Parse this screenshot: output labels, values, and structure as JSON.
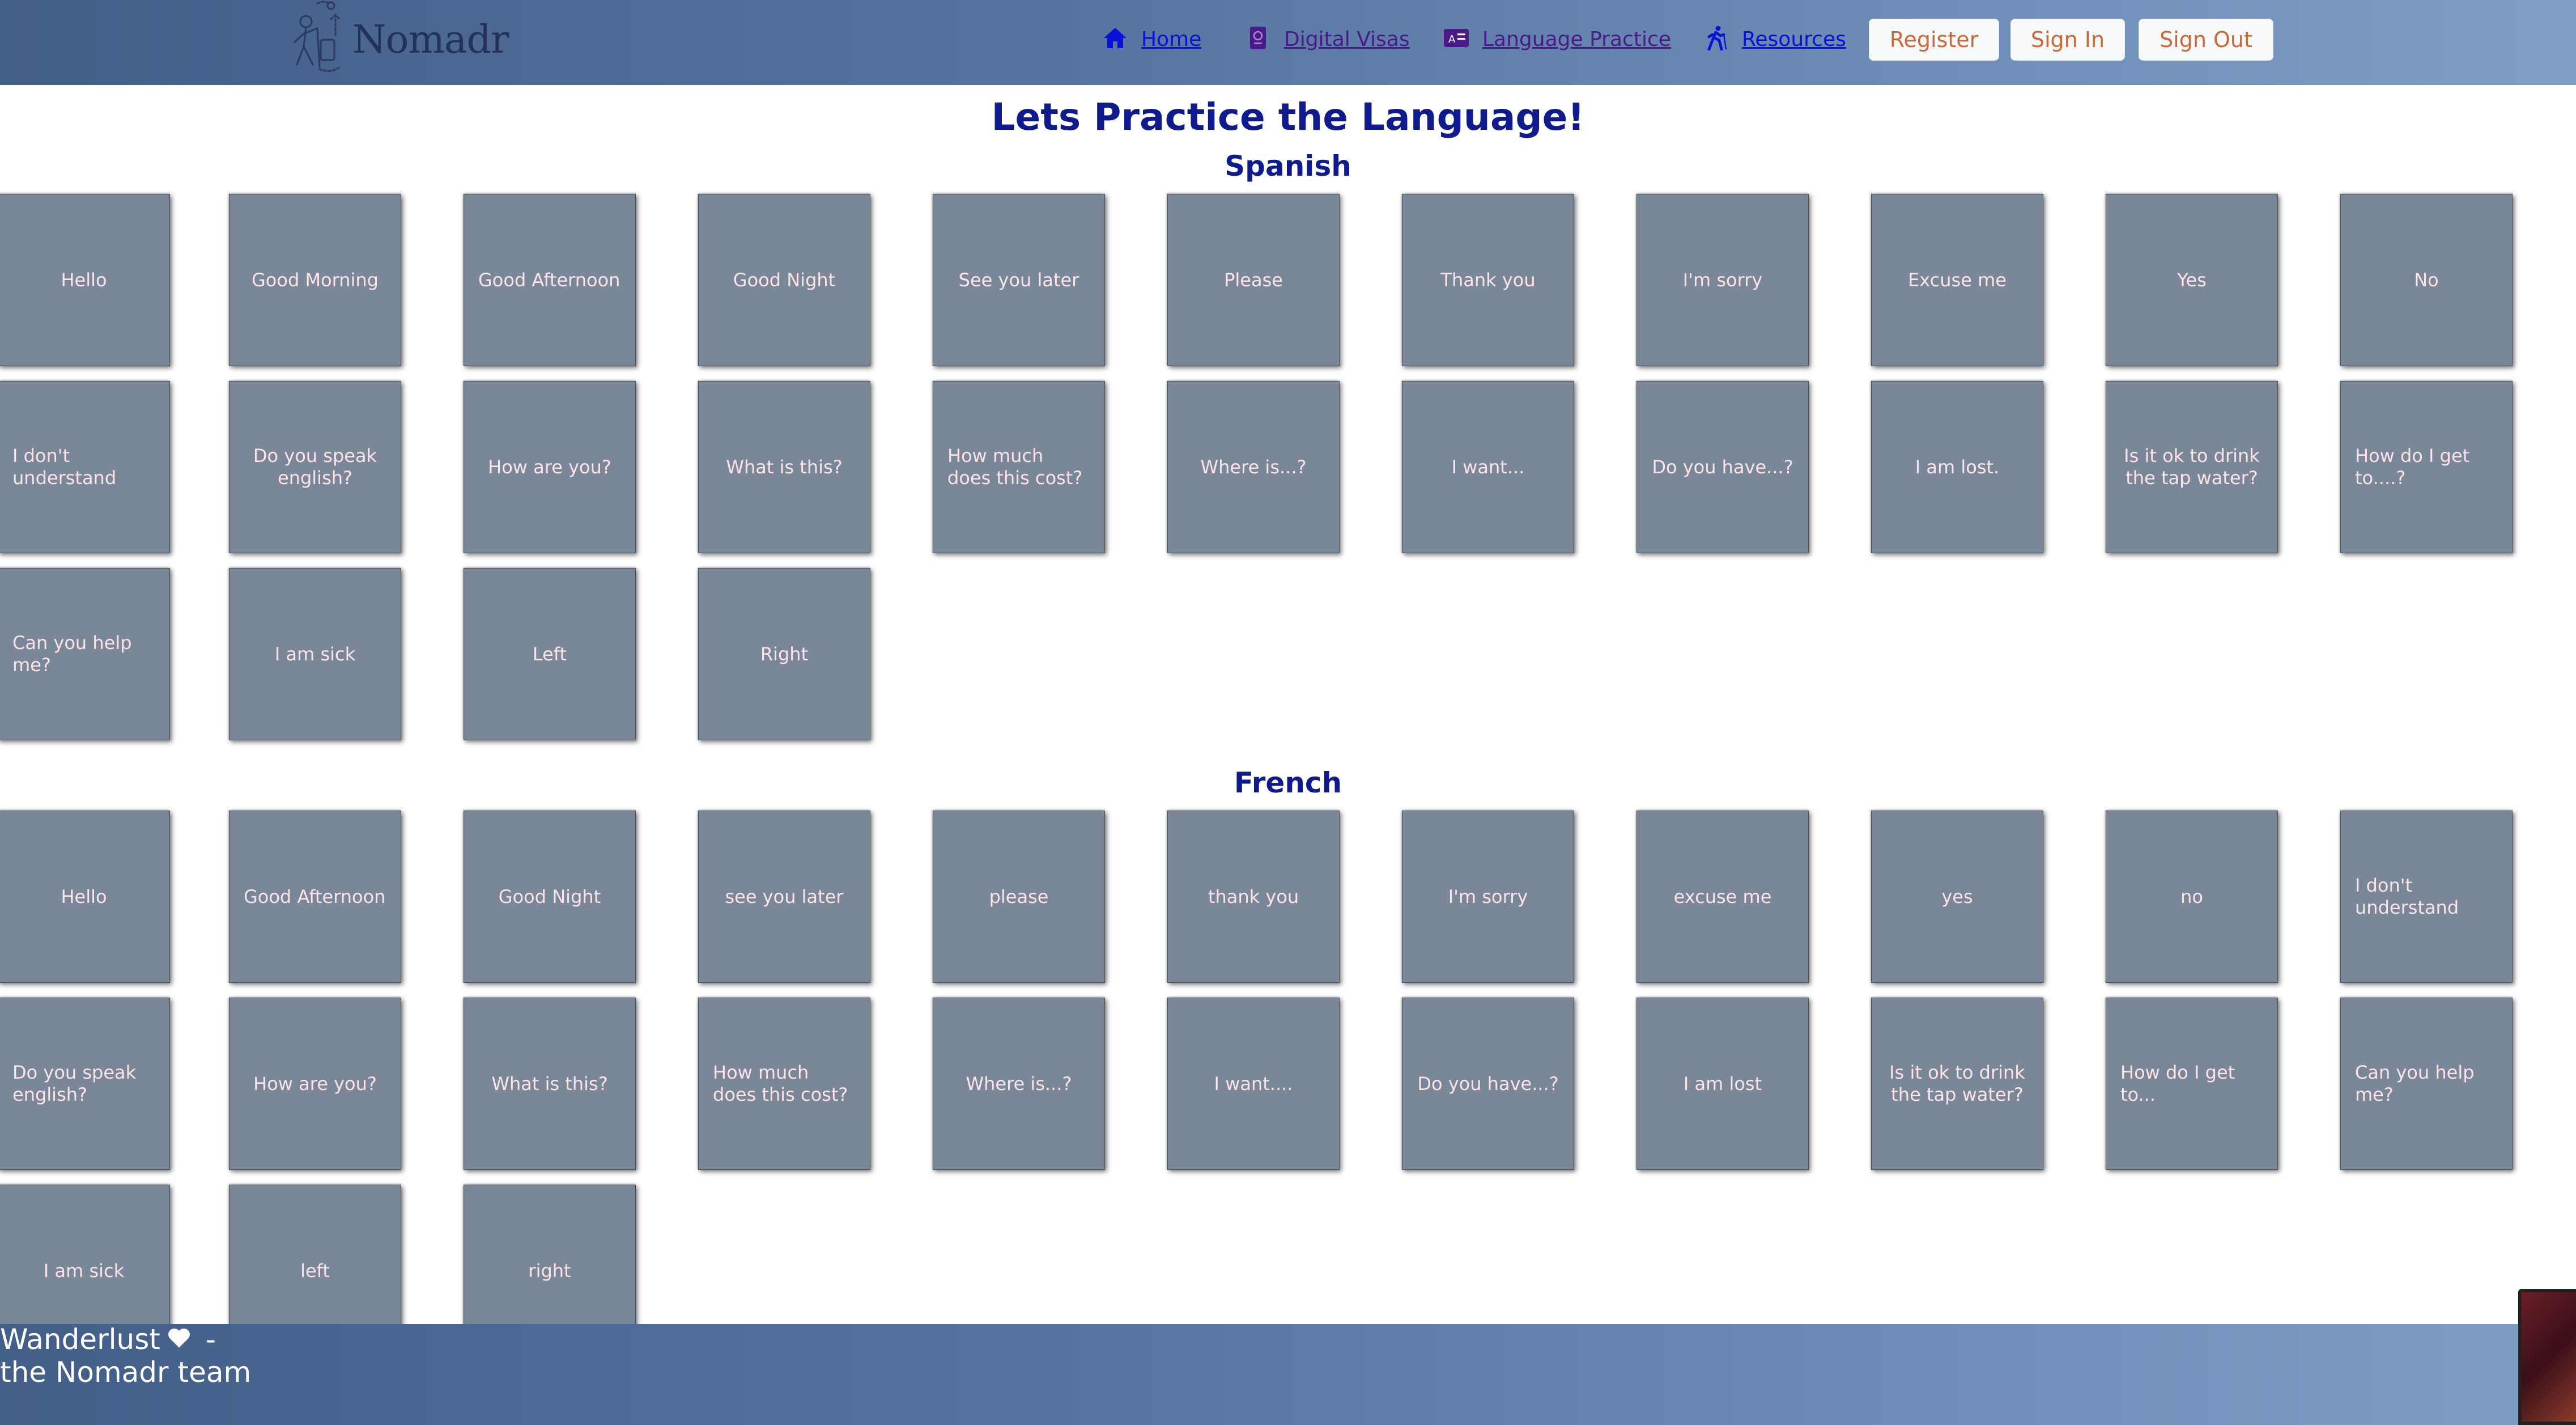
{
  "brand": {
    "name": "Nomadr",
    "logo_icon": "traveler-icon"
  },
  "nav": [
    {
      "label": "Home",
      "icon": "home-icon"
    },
    {
      "label": "Digital Visas",
      "icon": "passport-icon"
    },
    {
      "label": "Language Practice",
      "icon": "language-icon"
    },
    {
      "label": "Resources",
      "icon": "hiker-icon"
    }
  ],
  "auth": {
    "register": "Register",
    "sign_in": "Sign In",
    "sign_out": "Sign Out"
  },
  "main": {
    "title": "Lets Practice the Language!",
    "sections": [
      {
        "name": "Spanish",
        "cards": [
          "Hello",
          "Good Morning",
          "Good Afternoon",
          "Good Night",
          "See you later",
          "Please",
          "Thank you",
          "I'm sorry",
          "Excuse me",
          "Yes",
          "No",
          "I don't understand",
          "Do you speak english?",
          "How are you?",
          "What is this?",
          "How much does this cost?",
          "Where is...?",
          "I want...",
          "Do you have...?",
          "I am lost.",
          "Is it ok to drink the tap water?",
          "How do I get to....?",
          "Can you help me?",
          "I am sick",
          "Left",
          "Right"
        ]
      },
      {
        "name": "French",
        "cards": [
          "Hello",
          "Good Afternoon",
          "Good Night",
          "see you later",
          "please",
          "thank you",
          "I'm sorry",
          "excuse me",
          "yes",
          "no",
          "I don't understand",
          "Do you speak english?",
          "How are you?",
          "What is this?",
          "How much does this cost?",
          "Where is...?",
          "I want....",
          "Do you have...?",
          "I am lost",
          "Is it ok to drink the tap water?",
          "How do I get to...",
          "Can you help me?",
          "I am sick",
          "left",
          "right"
        ]
      }
    ]
  },
  "footer": {
    "line1": "Wanderlust",
    "line1_suffix": "-",
    "line2": "the Nomadr team",
    "icon": "heart-icon"
  }
}
